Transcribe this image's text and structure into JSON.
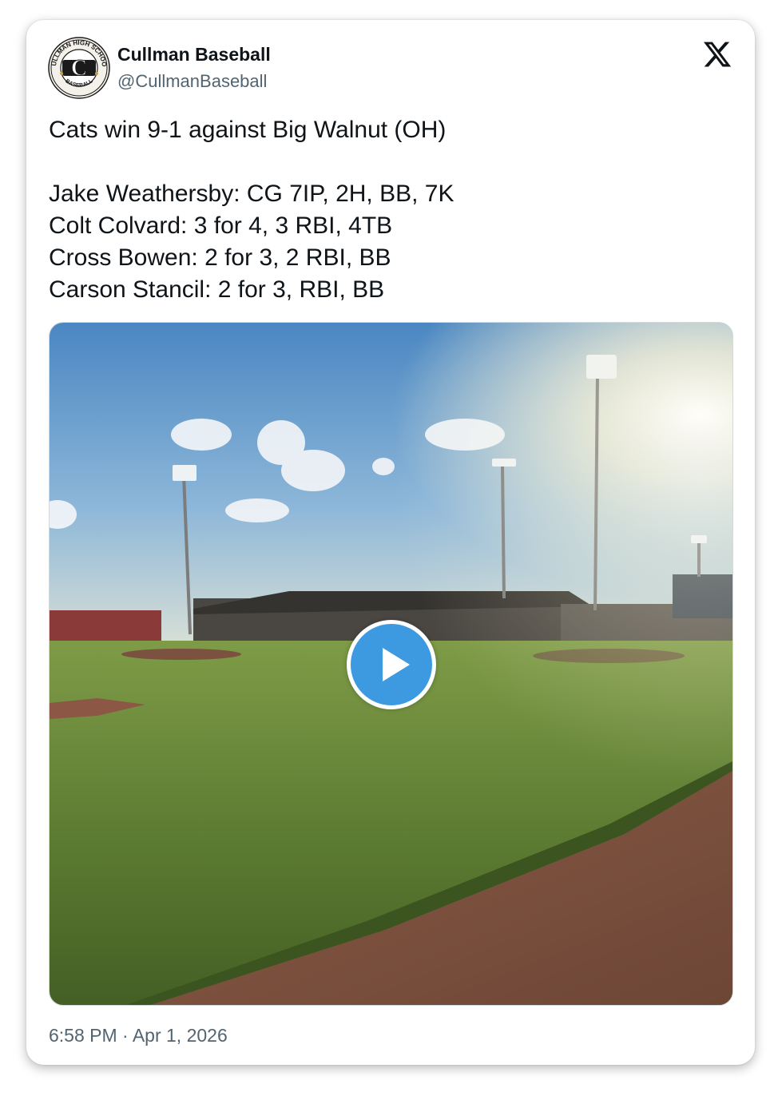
{
  "author": {
    "display_name": "Cullman Baseball",
    "handle": "@CullmanBaseball",
    "avatar": {
      "icon": "cullman-baseball-logo",
      "ring_text_top": "CULLMAN HIGH SCHOOL",
      "ring_text_bottom": "BASEBALL",
      "letter": "C"
    }
  },
  "platform_icon": "x-logo-icon",
  "tweet": {
    "headline": "Cats win 9-1 against Big Walnut (OH)",
    "stat_lines": [
      "Jake Weathersby: CG 7IP, 2H, BB, 7K",
      "Colt Colvard: 3 for 4, 3 RBI, 4TB",
      "Cross Bowen: 2 for 3, 2 RBI, BB",
      "Carson Stancil: 2 for 3, RBI, BB"
    ]
  },
  "media": {
    "type": "video",
    "description_icon": "baseball-field-video-thumbnail",
    "play_icon": "play-icon",
    "accent_color": "#3d9ae0"
  },
  "timestamp": "6:58 PM · Apr 1, 2026",
  "colors": {
    "text_primary": "#0f1419",
    "text_secondary": "#536471"
  }
}
